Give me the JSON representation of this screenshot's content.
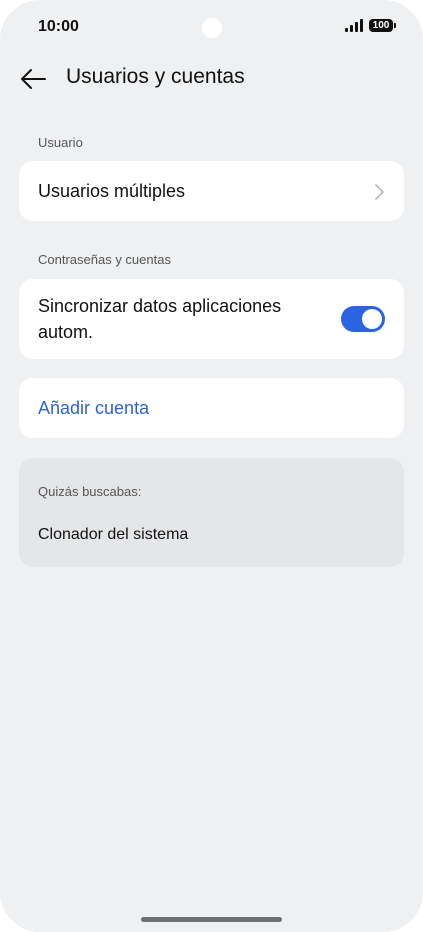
{
  "status_bar": {
    "time": "10:00",
    "battery": "100"
  },
  "header": {
    "back_icon": "arrow-left-icon",
    "title": "Usuarios y cuentas"
  },
  "sections": {
    "user_label": "Usuario",
    "multiple_users": "Usuarios múltiples",
    "accounts_label": "Contraseñas y cuentas",
    "sync_line1": "Sincronizar datos aplicaciones",
    "sync_line2": "autom.",
    "sync_enabled": true,
    "add_account": "Añadir cuenta"
  },
  "suggestions": {
    "label": "Quizás buscabas:",
    "item": "Clonador del sistema"
  },
  "colors": {
    "accent": "#2b64e3",
    "link": "#2f62d6",
    "background": "#eff0f2"
  }
}
